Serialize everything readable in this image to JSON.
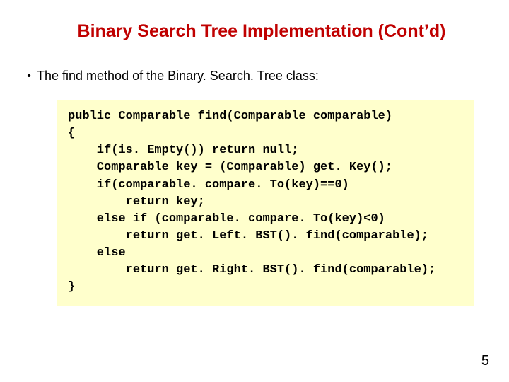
{
  "title": "Binary Search Tree Implementation (Cont’d)",
  "bullet": "The find method of the Binary. Search. Tree class:",
  "code_lines": [
    "public Comparable find(Comparable comparable)",
    "{",
    "    if(is. Empty()) return null;",
    "    Comparable key = (Comparable) get. Key();",
    "    if(comparable. compare. To(key)==0)",
    "        return key;",
    "    else if (comparable. compare. To(key)<0)",
    "        return get. Left. BST(). find(comparable);",
    "    else",
    "        return get. Right. BST(). find(comparable);",
    "}"
  ],
  "page_number": "5"
}
